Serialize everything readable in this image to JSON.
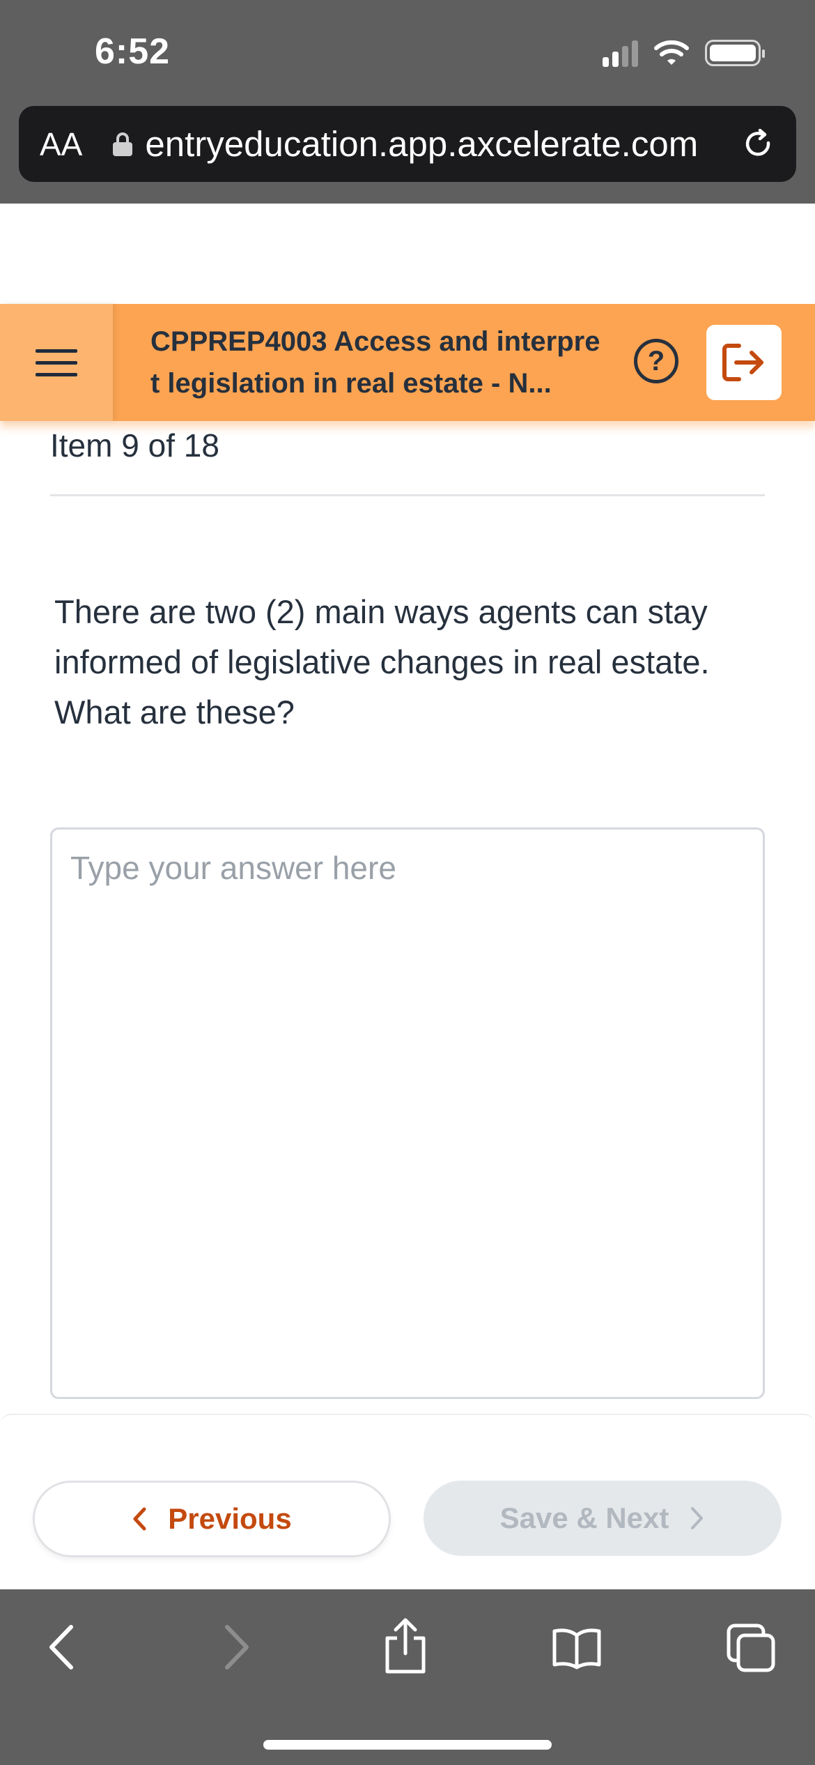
{
  "status_bar": {
    "time": "6:52"
  },
  "browser": {
    "text_size_label": "AA",
    "url": "entryeducation.app.axcelerate.com"
  },
  "header": {
    "course_title": "CPPREP4003 Access and interpret legislation in real estate - N..."
  },
  "progress": {
    "item_label": "Item 9 of 18"
  },
  "question": {
    "text": "There are two (2) main ways agents can stay informed of legislative changes in real estate. What are these?"
  },
  "answer": {
    "placeholder": "Type your answer here",
    "value": ""
  },
  "navigation": {
    "previous_label": "Previous",
    "next_label": "Save & Next"
  },
  "colors": {
    "header_bg": "#fca452",
    "accent": "#c44a0f",
    "chrome": "#5f5f5f"
  }
}
